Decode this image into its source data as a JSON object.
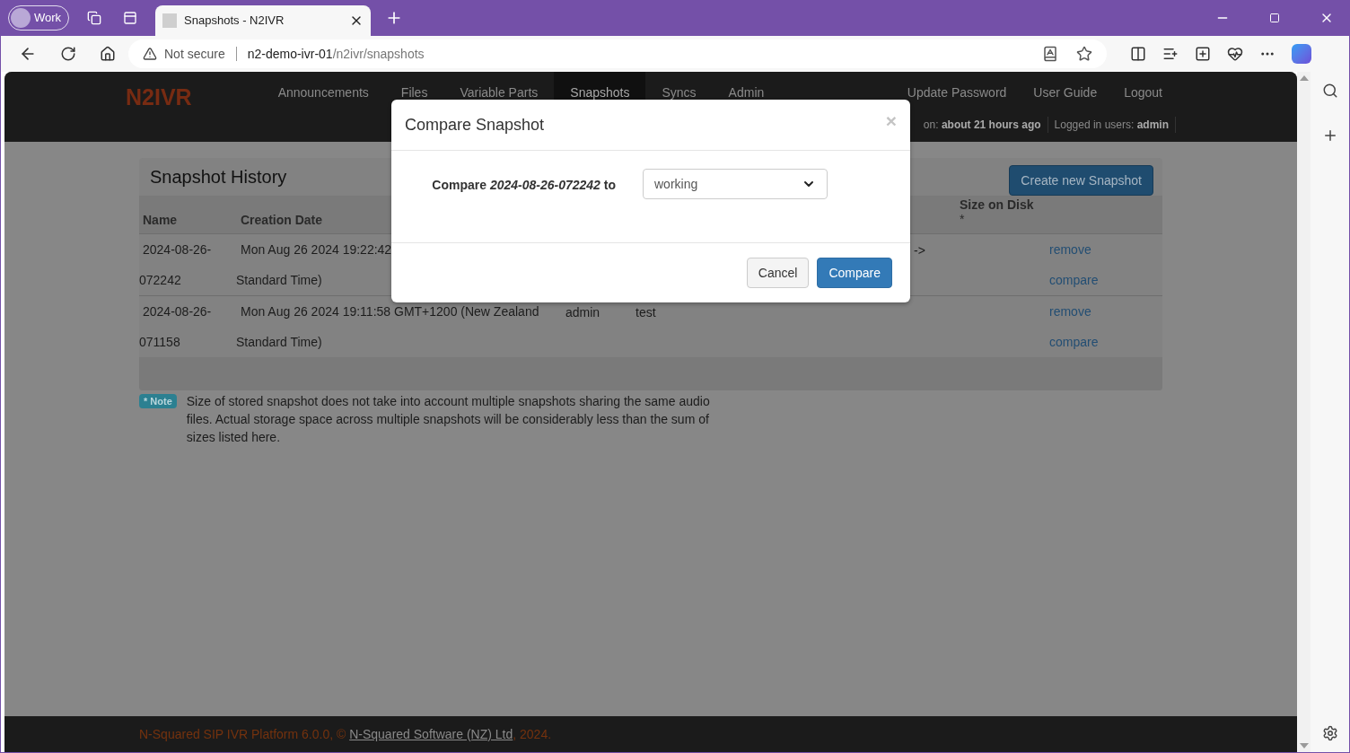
{
  "browser": {
    "profile": "Work",
    "tab_title": "Snapshots - N2IVR",
    "address": {
      "warning": "Not secure",
      "host": "n2-demo-ivr-01",
      "path": "/n2ivr/snapshots"
    }
  },
  "app": {
    "brand": "N2IVR",
    "nav": [
      {
        "label": "Announcements",
        "selected": false
      },
      {
        "label": "Files",
        "selected": false
      },
      {
        "label": "Variable Parts",
        "selected": false
      },
      {
        "label": "Snapshots",
        "selected": true
      },
      {
        "label": "Syncs",
        "selected": false
      },
      {
        "label": "Admin",
        "selected": false
      }
    ],
    "right_links": [
      "Update Password",
      "User Guide",
      "Logout"
    ],
    "status": [
      {
        "label": "on:",
        "value": "about 21 hours ago"
      },
      {
        "label": "Logged in users:",
        "value": "admin"
      }
    ]
  },
  "panel": {
    "title": "Snapshot History",
    "create_button": "Create new Snapshot",
    "columns": [
      {
        "label": "Name"
      },
      {
        "label": "Creation Date"
      },
      {
        "label": "Size on Disk",
        "note": "*"
      }
    ],
    "rows": [
      {
        "name_lines": [
          "2024-08-26-",
          "072242"
        ],
        "date_lines": [
          "Mon Aug 26 2024 19:22:42",
          "Standard Time)"
        ],
        "column_5": "->",
        "actions": [
          "remove",
          "compare"
        ]
      },
      {
        "name_lines": [
          "2024-08-26-",
          "071158"
        ],
        "date_lines": [
          "Mon Aug 26 2024 19:11:58 GMT+1200 (New Zealand",
          "Standard Time)"
        ],
        "user": "admin",
        "comment": "test",
        "actions": [
          "remove",
          "compare"
        ]
      }
    ]
  },
  "note": {
    "badge": "* Note",
    "text": "Size of stored snapshot does not take into account multiple snapshots sharing the same audio files. Actual storage space across multiple snapshots will be considerably less than the sum of sizes listed here."
  },
  "footer": {
    "prefix": "N-Squared SIP IVR Platform 6.0.0, ©",
    "link": "N-Squared Software (NZ) Ltd",
    "suffix": ", 2024."
  },
  "modal": {
    "title": "Compare Snapshot",
    "close": "×",
    "label": "Compare *2024-08-26-072242* to",
    "select_value": "working",
    "buttons": [
      {
        "label": "Cancel",
        "kind": "default"
      },
      {
        "label": "Compare",
        "kind": "primary"
      }
    ]
  }
}
